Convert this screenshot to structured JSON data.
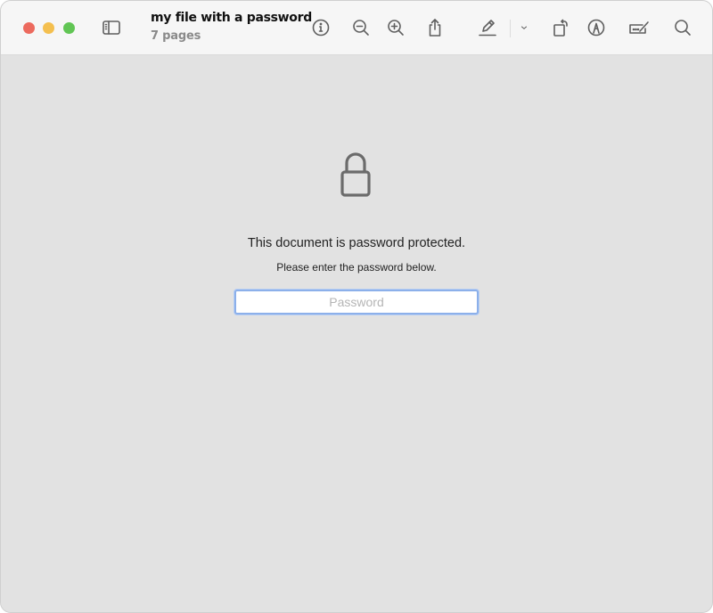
{
  "window": {
    "title": "my file with a password",
    "subtitle": "7 pages"
  },
  "toolbar": {
    "icons": [
      {
        "name": "sidebar-toggle-icon"
      },
      {
        "name": "info-icon"
      },
      {
        "name": "zoom-out-icon"
      },
      {
        "name": "zoom-in-icon"
      },
      {
        "name": "share-icon"
      },
      {
        "name": "highlight-pen-icon"
      },
      {
        "name": "chevron-down-icon"
      },
      {
        "name": "rotate-icon"
      },
      {
        "name": "markup-icon"
      },
      {
        "name": "signature-icon"
      },
      {
        "name": "search-icon"
      }
    ]
  },
  "content": {
    "lock_icon": "lock-icon",
    "message": "This document is password protected.",
    "submessage": "Please enter the password below.",
    "password_placeholder": "Password",
    "password_value": ""
  },
  "colors": {
    "close": "#ec6a5e",
    "minimize": "#f4bf4f",
    "maximize": "#61c554",
    "focus_ring": "#8cb0ea",
    "background": "#e2e2e2"
  }
}
